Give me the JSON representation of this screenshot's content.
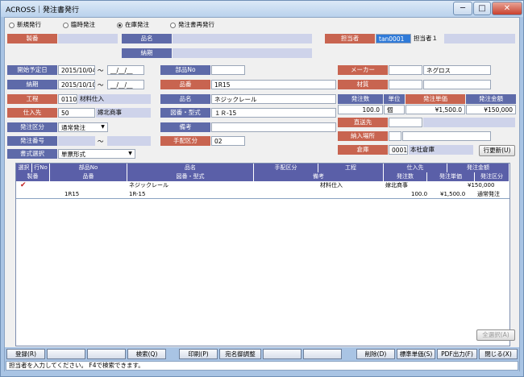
{
  "window": {
    "title": "ACROSS｜発注書発行",
    "minimize": "─",
    "maximize": "□",
    "close": "✕"
  },
  "issue_type": {
    "options": [
      "新規発行",
      "臨時発注",
      "在庫発注",
      "発注書再発行"
    ],
    "selected": 2
  },
  "labels": {
    "seiban": "製番",
    "hinmei": "品名",
    "nouki": "納期",
    "tantousha": "担当者",
    "kaishi_yotei": "開始予定日",
    "nouki2": "納期",
    "koutei": "工程",
    "shiiresaki": "仕入先",
    "hacchu_kubun": "発注区分",
    "hacchu_bangou": "発注番号",
    "shoshiki": "書式選択",
    "buhin_no": "部品No",
    "hinban": "品番",
    "hinmei2": "品名",
    "zuban": "図番・型式",
    "bikou": "備考",
    "tehai_kubun": "手配区分",
    "maker": "メーカー",
    "zaishitsu": "材質",
    "hacchu_suu": "発注数",
    "tani": "単位",
    "hacchu_tanka": "発注単価",
    "hacchu_kingaku": "発注金額",
    "chokusou": "直送先",
    "nounyu_basho": "納入場所",
    "souko": "倉庫"
  },
  "values": {
    "tantousha_code": "tan0001",
    "tantousha_name": "担当者１",
    "kaishi_from": "2015/10/04",
    "kaishi_to": "__/__/__",
    "tilde": "～",
    "nouki_from": "2015/10/10",
    "nouki_to": "__/__/__",
    "koutei_code": "0110",
    "koutei_name": "材料仕入",
    "shiiresaki_code": "50",
    "shiiresaki_name": "嫁北商事",
    "hacchu_kubun": "通常発注",
    "shoshiki": "単票形式",
    "hinban": "1R15",
    "hinmei": "ネジックレール",
    "zuban": "１Ｒ-15",
    "tehai_kubun": "02",
    "maker": "ネグロス",
    "hacchu_suu": "100.0",
    "tani": "個",
    "hacchu_tanka": "¥1,500.0",
    "hacchu_kingaku": "¥150,000",
    "souko_code": "0001",
    "souko_name": "本社倉庫"
  },
  "buttons": {
    "gyou_koushin": "行更新(U)",
    "zen_sentaku": "全選択(A)"
  },
  "grid": {
    "header1": [
      "選択",
      "行No",
      "部品No",
      "品名",
      "手配区分",
      "工程",
      "仕入先",
      "発注金額"
    ],
    "header2": [
      "製番",
      "品番",
      "図番・型式",
      "備考",
      "発注数",
      "発注単価",
      "発注区分"
    ],
    "rows": [
      {
        "selected": true,
        "check": "✔",
        "line1": {
          "hinmei": "ネジックレール",
          "koutei": "材料仕入",
          "shiiresaki": "嫁北商事",
          "kingaku": "¥150,000"
        },
        "line2": {
          "hinban": "1R15",
          "zuban": "1R-15",
          "suu": "100.0",
          "tanka": "¥1,500.0",
          "kubun": "通常発注"
        }
      }
    ]
  },
  "footer_buttons": [
    "登録(R)",
    "",
    "",
    "検索(Q)",
    "印刷(P)",
    "宛名御調整",
    "",
    "",
    "削除(D)",
    "標準単価(S)",
    "PDF出力(F)",
    "閉じる(X)"
  ],
  "status": "担当者を入力してください。 F4で検索できます。",
  "colors": {
    "label_red": "#c86450",
    "label_navy": "#5e6aa9",
    "frame": "#a9c4e4"
  }
}
